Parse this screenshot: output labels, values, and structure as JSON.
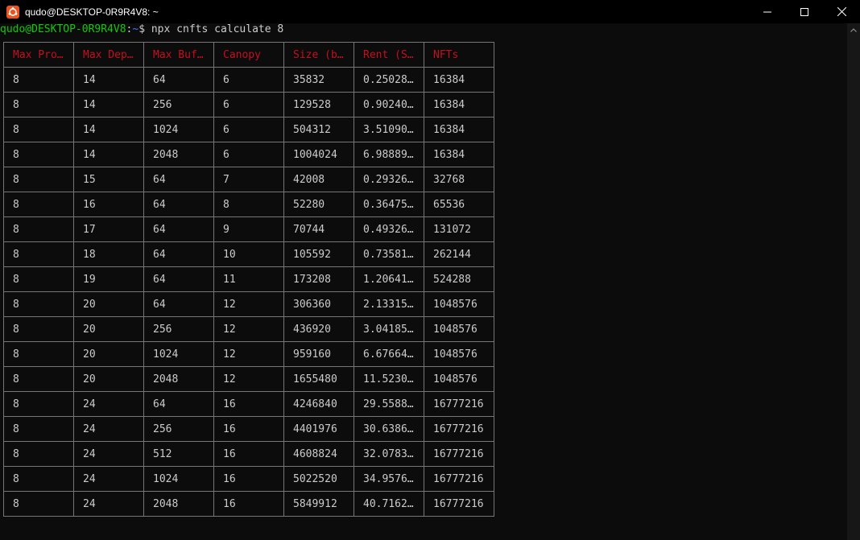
{
  "window": {
    "title": "qudo@DESKTOP-0R9R4V8: ~"
  },
  "prompt": {
    "user": "qudo@DESKTOP-0R9R4V8",
    "sep": ":",
    "path": "~",
    "symbol": "$ ",
    "command": "npx cnfts calculate 8"
  },
  "table": {
    "headers": [
      "Max Pro…",
      "Max Dep…",
      "Max Buf…",
      "Canopy",
      "Size (b…",
      "Rent (S…",
      "NFTs"
    ],
    "rows": [
      [
        "8",
        "14",
        "64",
        "6",
        "35832",
        "0.25028…",
        "16384"
      ],
      [
        "8",
        "14",
        "256",
        "6",
        "129528",
        "0.90240…",
        "16384"
      ],
      [
        "8",
        "14",
        "1024",
        "6",
        "504312",
        "3.51090…",
        "16384"
      ],
      [
        "8",
        "14",
        "2048",
        "6",
        "1004024",
        "6.98889…",
        "16384"
      ],
      [
        "8",
        "15",
        "64",
        "7",
        "42008",
        "0.29326…",
        "32768"
      ],
      [
        "8",
        "16",
        "64",
        "8",
        "52280",
        "0.36475…",
        "65536"
      ],
      [
        "8",
        "17",
        "64",
        "9",
        "70744",
        "0.49326…",
        "131072"
      ],
      [
        "8",
        "18",
        "64",
        "10",
        "105592",
        "0.73581…",
        "262144"
      ],
      [
        "8",
        "19",
        "64",
        "11",
        "173208",
        "1.20641…",
        "524288"
      ],
      [
        "8",
        "20",
        "64",
        "12",
        "306360",
        "2.13315…",
        "1048576"
      ],
      [
        "8",
        "20",
        "256",
        "12",
        "436920",
        "3.04185…",
        "1048576"
      ],
      [
        "8",
        "20",
        "1024",
        "12",
        "959160",
        "6.67664…",
        "1048576"
      ],
      [
        "8",
        "20",
        "2048",
        "12",
        "1655480",
        "11.5230…",
        "1048576"
      ],
      [
        "8",
        "24",
        "64",
        "16",
        "4246840",
        "29.5588…",
        "16777216"
      ],
      [
        "8",
        "24",
        "256",
        "16",
        "4401976",
        "30.6386…",
        "16777216"
      ],
      [
        "8",
        "24",
        "512",
        "16",
        "4608824",
        "32.0783…",
        "16777216"
      ],
      [
        "8",
        "24",
        "1024",
        "16",
        "5022520",
        "34.9576…",
        "16777216"
      ],
      [
        "8",
        "24",
        "2048",
        "16",
        "5849912",
        "40.7162…",
        "16777216"
      ]
    ]
  },
  "colors": {
    "header_text": "#c50f1f",
    "prompt_user": "#16c60c",
    "prompt_path": "#3b78ff",
    "app_icon": "#e95420"
  },
  "icons": [
    "ubuntu-icon",
    "minimize-icon",
    "maximize-icon",
    "close-icon",
    "scroll-up-icon"
  ]
}
